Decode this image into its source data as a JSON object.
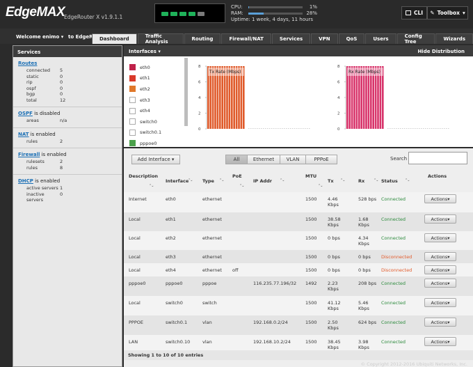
{
  "app": {
    "logo": "EdgeMAX",
    "model": "EdgeRouter X v1.9.1.1"
  },
  "ports": {
    "colors": [
      "#1fb25a",
      "#1fb25a",
      "#1fb25a",
      "#1fb25a",
      "#7a7a7a"
    ]
  },
  "stats": {
    "cpu_label": "CPU:",
    "cpu_val": "1%",
    "cpu": 0.01,
    "ram_label": "RAM:",
    "ram_val": "28%",
    "ram": 0.28,
    "uptime_label": "Uptime:",
    "uptime_val": "1 week, 4 days, 11 hours"
  },
  "toolbar": {
    "cli": "CLI",
    "toolbox": "Toolbox"
  },
  "nav": {
    "welcome": "Welcome enimo",
    "to": "to EdgeRo",
    "tabs": [
      "Dashboard",
      "Traffic Analysis",
      "Routing",
      "Firewall/NAT",
      "Services",
      "VPN",
      "QoS",
      "Users",
      "Config Tree",
      "Wizards"
    ],
    "active": 0
  },
  "services": {
    "title": "Services",
    "routes": {
      "head": "Routes",
      "items": [
        [
          "connected",
          "5"
        ],
        [
          "static",
          "0"
        ],
        [
          "rip",
          "0"
        ],
        [
          "ospf",
          "0"
        ],
        [
          "bgp",
          "0"
        ],
        [
          "total",
          "12"
        ]
      ]
    },
    "ospf": {
      "link": "OSPF",
      "text": " is disabled",
      "items": [
        [
          "areas",
          "n/a"
        ]
      ]
    },
    "nat": {
      "link": "NAT",
      "text": " is enabled",
      "items": [
        [
          "rules",
          "2"
        ]
      ]
    },
    "firewall": {
      "link": "Firewall",
      "text": " is enabled",
      "items": [
        [
          "rulesets",
          "2"
        ],
        [
          "rules",
          "8"
        ]
      ]
    },
    "dhcp": {
      "link": "DHCP",
      "text": " is enabled",
      "items": [
        [
          "active servers",
          "1"
        ],
        [
          "inactive servers",
          "0"
        ]
      ]
    }
  },
  "charts": {
    "interfaces": "Interfaces",
    "hide": "Hide Distribution",
    "tx_label": "Tx Rate (Mbps)",
    "rx_label": "Rx Rate (Mbps)",
    "ticks": [
      "8",
      "6",
      "4",
      "2",
      "0"
    ],
    "legend": [
      {
        "name": "eth0",
        "color": "#c0224a"
      },
      {
        "name": "eth1",
        "color": "#d93a2a"
      },
      {
        "name": "eth2",
        "color": "#e0782a"
      },
      {
        "name": "eth3",
        "color": "#ffffff"
      },
      {
        "name": "eth4",
        "color": "#ffffff"
      },
      {
        "name": "switch0",
        "color": "#ffffff"
      },
      {
        "name": "switch0.1",
        "color": "#ffffff"
      },
      {
        "name": "pppoe0",
        "color": "#4aa04a"
      }
    ],
    "tx_color": "#e05a2a",
    "rx_color": "#d8336a"
  },
  "chart_data": [
    {
      "type": "bar",
      "title": "Tx Rate (Mbps)",
      "ylim": [
        0,
        8
      ],
      "values": [
        8,
        8,
        8,
        8,
        8,
        8,
        8,
        8,
        8,
        8,
        8,
        8,
        8,
        8,
        8,
        8
      ]
    },
    {
      "type": "bar",
      "title": "Rx Rate (Mbps)",
      "ylim": [
        0,
        8
      ],
      "values": [
        8,
        8,
        8,
        8,
        8,
        8,
        8,
        8,
        8,
        8,
        8,
        8,
        8,
        8,
        8,
        8
      ]
    }
  ],
  "table": {
    "add": "Add Interface",
    "filters": [
      "All",
      "Ethernet",
      "VLAN",
      "PPPoE"
    ],
    "search": "Search",
    "cols": [
      "Description",
      "Interface",
      "Type",
      "PoE",
      "IP Addr",
      "MTU",
      "Tx",
      "Rx",
      "Status",
      "Actions"
    ],
    "rows": [
      [
        "Internet",
        "eth0",
        "ethernet",
        "",
        "",
        "1500",
        "4.46 Kbps",
        "528 bps",
        "Connected"
      ],
      [
        "Local",
        "eth1",
        "ethernet",
        "",
        "",
        "1500",
        "38.58 Kbps",
        "1.68 Kbps",
        "Connected"
      ],
      [
        "Local",
        "eth2",
        "ethernet",
        "",
        "",
        "1500",
        "0 bps",
        "4.34 Kbps",
        "Connected"
      ],
      [
        "Local",
        "eth3",
        "ethernet",
        "",
        "",
        "1500",
        "0 bps",
        "0 bps",
        "Disconnected"
      ],
      [
        "Local",
        "eth4",
        "ethernet",
        "off",
        "",
        "1500",
        "0 bps",
        "0 bps",
        "Disconnected"
      ],
      [
        "pppoe0",
        "pppoe0",
        "pppoe",
        "",
        "116.235.77.196/32",
        "1492",
        "2.23 Kbps",
        "208 bps",
        "Connected"
      ],
      [
        "Local",
        "switch0",
        "switch",
        "",
        "",
        "1500",
        "41.12 Kbps",
        "5.46 Kbps",
        "Connected"
      ],
      [
        "PPPOE",
        "switch0.1",
        "vlan",
        "",
        "192.168.0.2/24",
        "1500",
        "2.50 Kbps",
        "624 bps",
        "Connected"
      ],
      [
        "LAN",
        "switch0.10",
        "vlan",
        "",
        "192.168.10.2/24",
        "1500",
        "38.45 Kbps",
        "3.98 Kbps",
        "Connected"
      ]
    ],
    "actions": "Actions",
    "footer": "Showing 1 to 10 of 10 entries",
    "copyright": "© Copyright 2012-2016 Ubiquiti Networks, Inc."
  }
}
